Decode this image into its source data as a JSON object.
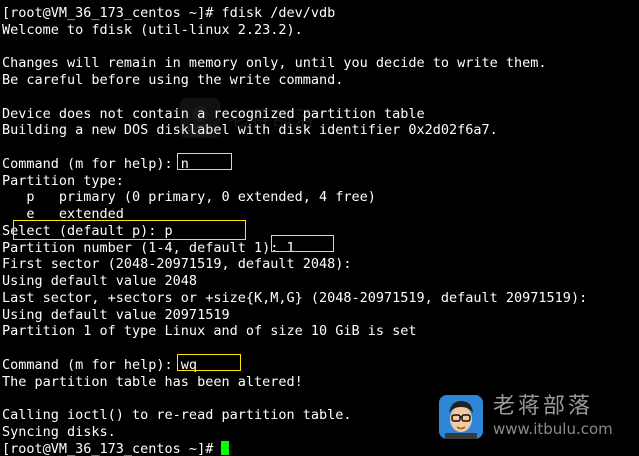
{
  "terminal": {
    "lines": [
      "[root@VM_36_173_centos ~]# fdisk /dev/vdb",
      "Welcome to fdisk (util-linux 2.23.2).",
      "",
      "Changes will remain in memory only, until you decide to write them.",
      "Be careful before using the write command.",
      "",
      "Device does not contain a recognized partition table",
      "Building a new DOS disklabel with disk identifier 0x2d02f6a7.",
      "",
      "Command (m for help): n",
      "Partition type:",
      "   p   primary (0 primary, 0 extended, 4 free)",
      "   e   extended",
      "Select (default p): p",
      "Partition number (1-4, default 1): 1",
      "First sector (2048-20971519, default 2048):",
      "Using default value 2048",
      "Last sector, +sectors or +size{K,M,G} (2048-20971519, default 20971519):",
      "Using default value 20971519",
      "Partition 1 of type Linux and of size 10 GiB is set",
      "",
      "Command (m for help): wq",
      "The partition table has been altered!",
      "",
      "Calling ioctl() to re-read partition table.",
      "Syncing disks."
    ],
    "prompt": "[root@VM_36_173_centos ~]# "
  },
  "watermark": {
    "name": "老蒋部落",
    "url": "www.itbulu.com"
  },
  "colors": {
    "background": "#000000",
    "text": "#ffffff",
    "cursor": "#00ff00",
    "highlight_box": "#ffe600"
  }
}
